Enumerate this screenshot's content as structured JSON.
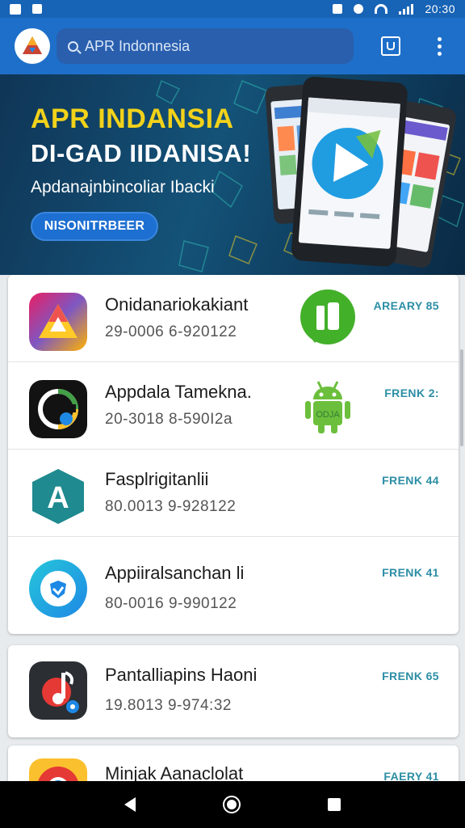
{
  "status_bar": {
    "time": "20:30"
  },
  "app_bar": {
    "search_placeholder": "APR Indonnesia"
  },
  "banner": {
    "title": "APR INDANSIA",
    "subtitle": "DI-GAD IIDANISA!",
    "description": "Apdanajnbincoliar Ibacki",
    "button_label": "NISONITRBEER"
  },
  "apps": [
    {
      "name": "Onidanariokakiant",
      "meta": "29-0006 6-920122",
      "badge": "AREARY 85",
      "icon": "triangle-app-icon"
    },
    {
      "name": "Appdala Tamekna.",
      "meta": "20-3018 8-590I2a",
      "badge": "FRENK 2:",
      "icon": "circle-app-icon"
    },
    {
      "name": "Fasplrigitanlii",
      "meta": "80.0013 9-928122",
      "badge": "FRENK 44",
      "icon": "letter-a-app-icon"
    },
    {
      "name": "Appiiralsanchan li",
      "meta": "80-0016 9-990122",
      "badge": "FRENK 41",
      "icon": "shield-app-icon"
    },
    {
      "name": "Pantalliapins Haoni",
      "meta": "19.8013 9-974:32",
      "badge": "FRENK 65",
      "icon": "music-app-icon"
    },
    {
      "name": "Minjak Aanaclolat",
      "meta": "",
      "badge": "FAERY 41",
      "icon": "chrome-app-icon"
    }
  ],
  "colors": {
    "app_bar": "#1e6fc9",
    "status_bar": "#1763b5",
    "banner_title": "#f2d21a",
    "badge": "#2c8ea5"
  }
}
